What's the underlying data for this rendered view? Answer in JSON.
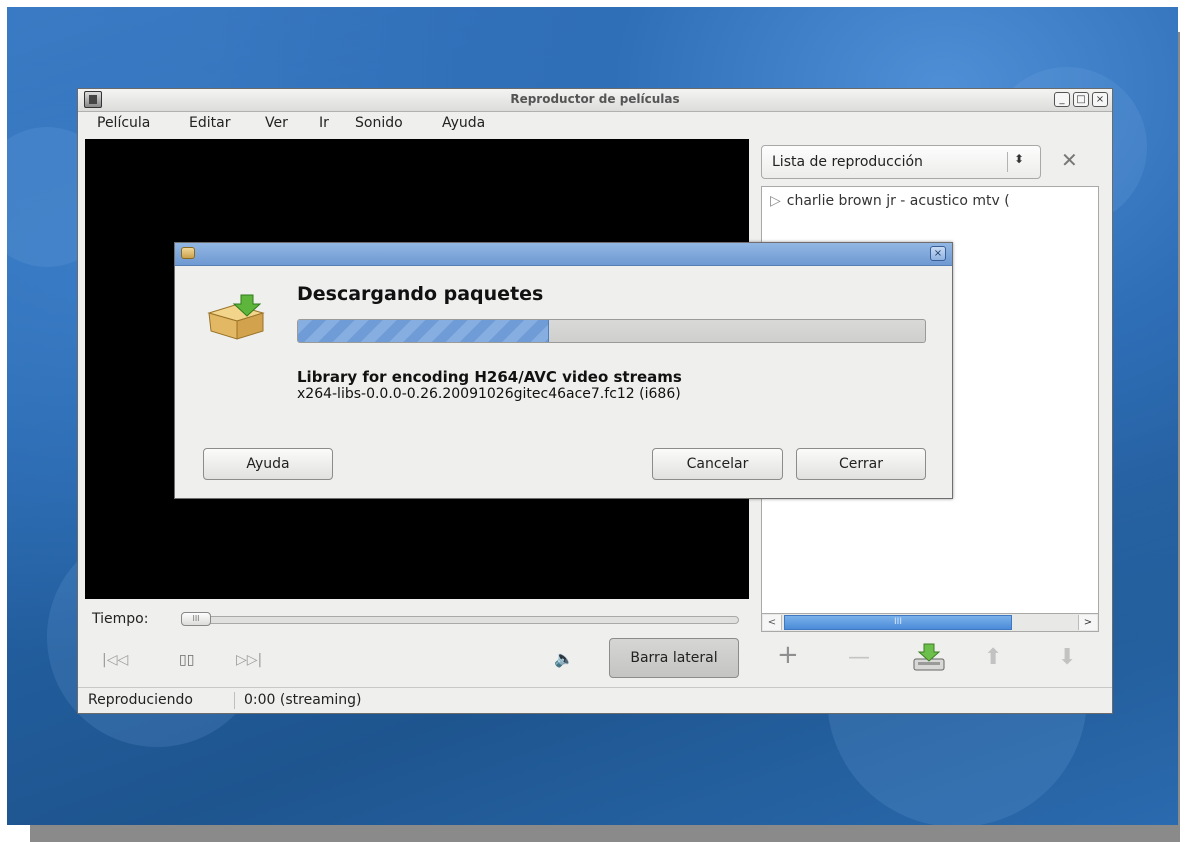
{
  "window": {
    "title": "Reproductor de películas",
    "minimize_glyph": "_",
    "maximize_glyph": "□",
    "close_glyph": "×"
  },
  "menubar": {
    "items": [
      "Película",
      "Editar",
      "Ver",
      "Ir",
      "Sonido",
      "Ayuda"
    ]
  },
  "sidebar": {
    "combo_label": "Lista de reproducción",
    "combo_arrow": "⬍",
    "close_glyph": "✕",
    "playlist": [
      {
        "play_glyph": "▷",
        "title": "charlie brown jr - acustico mtv ("
      }
    ],
    "scroll_left": "<",
    "scroll_right": ">",
    "scroll_grip": "III"
  },
  "controls": {
    "time_label": "Tiempo:",
    "seek_grip": "III",
    "prev_glyph": "|◁◁",
    "pause_glyph": "▯▯",
    "next_glyph": "▷▷|",
    "volume_glyph": "🔈",
    "sidebar_button": "Barra lateral",
    "add_glyph": "+",
    "remove_glyph": "—",
    "up_glyph": "⬆",
    "down_glyph": "⬇"
  },
  "statusbar": {
    "state": "Reproduciendo",
    "time": "0:00 (streaming)"
  },
  "dialog": {
    "close_glyph": "×",
    "heading": "Descargando paquetes",
    "progress": 0.4,
    "package_description": "Library for encoding H264/AVC video streams",
    "package_name": "x264-libs-0.0.0-0.26.20091026gitec46ace7.fc12 (i686)",
    "help_button": "Ayuda",
    "cancel_button": "Cancelar",
    "close_button": "Cerrar"
  },
  "colors": {
    "progress_fill": "#87aee0",
    "dialog_title": "#7ea6da",
    "desktop": "#2a66aa"
  }
}
